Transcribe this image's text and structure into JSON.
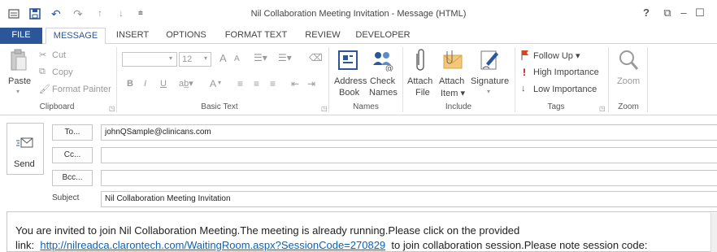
{
  "window": {
    "title": "Nil Collaboration Meeting Invitation - Message (HTML)",
    "help": "?",
    "restore_ribbon": "⧉",
    "minimize": "–",
    "maximize": "☐"
  },
  "quick_access": {
    "undo": "↶",
    "redo": "↷",
    "up": "↑",
    "down": "↓",
    "customize": "⩧"
  },
  "tabs": [
    "FILE",
    "MESSAGE",
    "INSERT",
    "OPTIONS",
    "FORMAT TEXT",
    "REVIEW",
    "DEVELOPER"
  ],
  "ribbon": {
    "clipboard": {
      "paste": "Paste",
      "cut": "Cut",
      "copy": "Copy",
      "format_painter": "Format Painter",
      "label": "Clipboard"
    },
    "basic_text": {
      "font_size": "12",
      "label": "Basic Text",
      "bold": "B",
      "italic": "I",
      "underline": "U",
      "grow": "A",
      "shrink": "A",
      "font_color": "A"
    },
    "names": {
      "address_book_1": "Address",
      "address_book_2": "Book",
      "check_names_1": "Check",
      "check_names_2": "Names",
      "label": "Names"
    },
    "include": {
      "attach_file_1": "Attach",
      "attach_file_2": "File",
      "attach_item_1": "Attach",
      "attach_item_2": "Item ▾",
      "signature": "Signature",
      "signature_arrow": "▾",
      "label": "Include"
    },
    "tags": {
      "follow_up": "Follow Up ▾",
      "high_importance": "High Importance",
      "low_importance": "Low Importance",
      "label": "Tags"
    },
    "zoom": {
      "zoom": "Zoom",
      "label": "Zoom"
    }
  },
  "compose": {
    "send": "Send",
    "to_button": "To...",
    "cc_button": "Cc...",
    "bcc_button": "Bcc...",
    "subject_label": "Subject",
    "to_value": "johnQSample@clinicans.com",
    "cc_value": "",
    "bcc_value": "",
    "subject_value": "Nil Collaboration Meeting Invitation"
  },
  "body": {
    "line1": "You are invited to join Nil Collaboration Meeting.The meeting is already running.Please click on the provided",
    "line2_prefix": "link:",
    "link": "http://nilreadca.clarontech.com/WaitingRoom.aspx?SessionCode=270829",
    "line2_suffix": "to join collaboration session.Please note session code:"
  },
  "colors": {
    "accent": "#2b579a",
    "link": "#0563c1",
    "flag": "#d24726",
    "high_importance": "#c00000"
  }
}
